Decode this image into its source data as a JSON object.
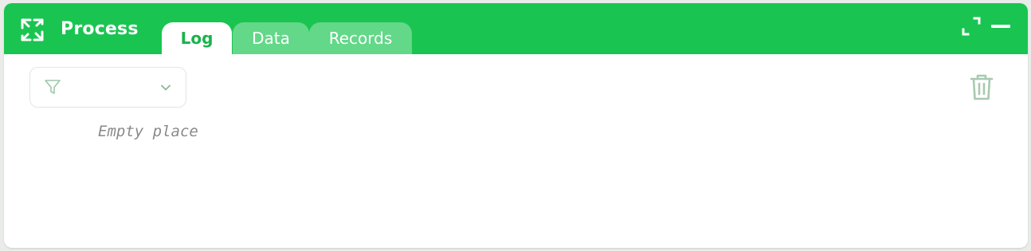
{
  "panel": {
    "title": "Process",
    "icon": "process-arrows-icon",
    "accent_color": "#1ac451",
    "tabs": [
      {
        "label": "Log",
        "active": true
      },
      {
        "label": "Data",
        "active": false
      },
      {
        "label": "Records",
        "active": false
      }
    ],
    "window_controls": {
      "expand_icon": "expand-icon",
      "minimize_icon": "minimize-icon"
    }
  },
  "log": {
    "filter": {
      "icon": "filter-icon",
      "selected_value": "",
      "dropdown_icon": "chevron-down-icon"
    },
    "empty_message": "Empty place",
    "clear_icon": "trash-icon"
  }
}
